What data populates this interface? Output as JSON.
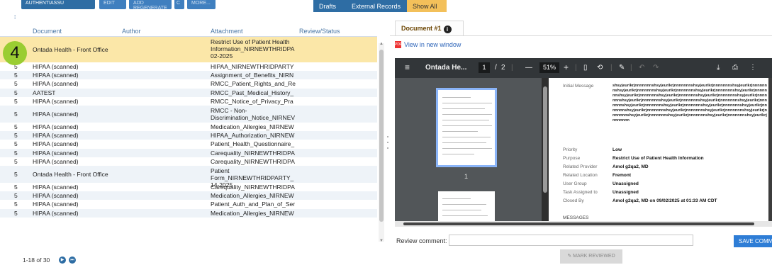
{
  "toolbar": {
    "select_label": "AUTHENTIASSU",
    "btn_edit": "EDIT",
    "btn_reassign": "ADD REGENERATE",
    "btn_refresh": "C",
    "btn_more": "MORE..."
  },
  "top_tabs": [
    "Drafts",
    "External Records",
    "Show All"
  ],
  "table": {
    "headers": [
      "Document",
      "Author",
      "Attachment",
      "Review/Status"
    ],
    "rows": [
      {
        "num": "4",
        "doc": "Ontada Health - Front Office",
        "att": "Restrict Use of Patient Health Information_NIRNEWTHRIDPA 02-2025",
        "selected": true
      },
      {
        "num": "5",
        "doc": "HIPAA (scanned)",
        "att": "HIPAA_NIRNEWTHRIDPARTY"
      },
      {
        "num": "5",
        "doc": "HIPAA (scanned)",
        "att": "Assignment_of_Benefits_NIRN"
      },
      {
        "num": "5",
        "doc": "HIPAA (scanned)",
        "att": "RMCC_Patient_Rights_and_Re"
      },
      {
        "num": "5",
        "doc": "AATEST",
        "att": "RMCC_Past_Medical_History_"
      },
      {
        "num": "5",
        "doc": "HIPAA (scanned)",
        "att": "RMCC_Notice_of_Privacy_Pra"
      },
      {
        "num": "5",
        "doc": "HIPAA (scanned)",
        "att": "RMCC - Non-Discrimination_Notice_NIRNEV"
      },
      {
        "num": "5",
        "doc": "HIPAA (scanned)",
        "att": "Medication_Allergies_NIRNEW"
      },
      {
        "num": "5",
        "doc": "HIPAA (scanned)",
        "att": "HIPAA_Authorization_NIRNEW"
      },
      {
        "num": "5",
        "doc": "HIPAA (scanned)",
        "att": "Patient_Health_Questionnaire_"
      },
      {
        "num": "5",
        "doc": "HIPAA (scanned)",
        "att": "Carequality_NIRNEWTHRIDPA"
      },
      {
        "num": "5",
        "doc": "HIPAA (scanned)",
        "att": "Carequality_NIRNEWTHRIDPA"
      },
      {
        "num": "5",
        "doc": "Ontada Health - Front Office",
        "att": "Patient Form_NIRNEWTHRIDPARTY_ 14-2025"
      },
      {
        "num": "5",
        "doc": "HIPAA (scanned)",
        "att": "Carequality_NIRNEWTHRIDPA"
      },
      {
        "num": "5",
        "doc": "HIPAA (scanned)",
        "att": "Medication_Allergies_NIRNEW"
      },
      {
        "num": "5",
        "doc": "HIPAA (scanned)",
        "att": "Patient_Auth_and_Plan_of_Ser"
      },
      {
        "num": "5",
        "doc": "HIPAA (scanned)",
        "att": "Medication_Allergies_NIRNEW"
      }
    ]
  },
  "badge": "4",
  "pager": "1-18 of 30",
  "doc_tab": "Document #1",
  "view_link": "View in new window",
  "viewer": {
    "title": "Ontada He...",
    "page_current": "1",
    "page_sep": "/",
    "page_total": "2",
    "zoom": "51%",
    "thumb_label": "1"
  },
  "page_fields": {
    "initial_message_label": "Initial Message",
    "initial_message_text": "shsyjeurikrjnnnnnnnshsyjeurikrjnnnnnnnshsyjeurikrjnnnnnnnshsyjeurikrjnnnnnnnshsyjeurikrjnnnnnnnshsyjeurikrjnnnnnnnshsyjeurikrjnnnnnnnshsyjeurikrjnnnnnnnshsyjeurikrjnnnnnnnshsyjeurikrjnnnnnnnshsyjeurikrjnnnnnnnshsyjeurikrjnnnnnnnshsyjeurikrjnnnnnnnshsyjeurikrjnnnnnnnshsyjeurikrjnnnnnnnshsyjeurikrjnnnnnnnshsyjeurikrjnnnnnnnshsyjeurikrjnnnnnnnshsyjeurikrjnnnnnnnshsyjeurikrjnnnnnnnshsyjeurikrjnnnnnnnshsyjeurikrjnnnnnnnshsyjeurikrjnnnnnnnshsyjeurikrjnnnnnnnshsyjeurikrjnnnnnnnshsyjeurikrjnnnnnnnshsyjeurikrjnnnnnnnshsyjeurikrjnnnnnnn",
    "rows": [
      {
        "label": "Priority",
        "value": "Low"
      },
      {
        "label": "Purpose",
        "value": "Restrict Use of Patient Health Information"
      },
      {
        "label": "Related Provider",
        "value": "Amol g2qa2, MD"
      },
      {
        "label": "Related Location",
        "value": "Fremont"
      },
      {
        "label": "User Group",
        "value": "Unassigned"
      },
      {
        "label": "Task Assigned to",
        "value": "Unassigned"
      },
      {
        "label": "Closed By",
        "value": "Amol g2qa2, MD on 09/02/2025 at 01:33 AM CDT"
      }
    ],
    "messages_label": "MESSAGES"
  },
  "review_label": "Review comment:",
  "save_button": "SAVE COMMENT",
  "mark_button": "MARK REVIEWED"
}
